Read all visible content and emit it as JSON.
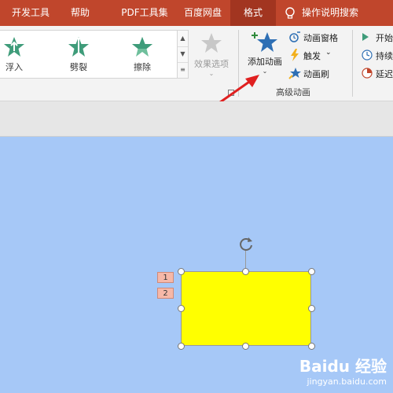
{
  "tabs": [
    {
      "label": "开发工具"
    },
    {
      "label": "帮助"
    },
    {
      "label": "PDF工具集"
    },
    {
      "label": "百度网盘"
    },
    {
      "label": "格式"
    },
    {
      "label": "操作说明搜索"
    }
  ],
  "gallery": {
    "items": [
      {
        "label": "浮入"
      },
      {
        "label": "劈裂"
      },
      {
        "label": "擦除"
      }
    ]
  },
  "effect_options": {
    "label": "效果选项"
  },
  "advanced": {
    "add_animation": "添加动画",
    "animation_pane": "动画窗格",
    "trigger": "触发",
    "animation_painter": "动画刷",
    "group_label": "高级动画"
  },
  "timing": {
    "start": "开始",
    "duration": "持续",
    "delay": "延迟"
  },
  "slide": {
    "animation_tags": [
      "1",
      "2"
    ],
    "shape_color": "#ffff00"
  },
  "watermark": {
    "brand": "Baidu 经验",
    "url": "jingyan.baidu.com"
  }
}
